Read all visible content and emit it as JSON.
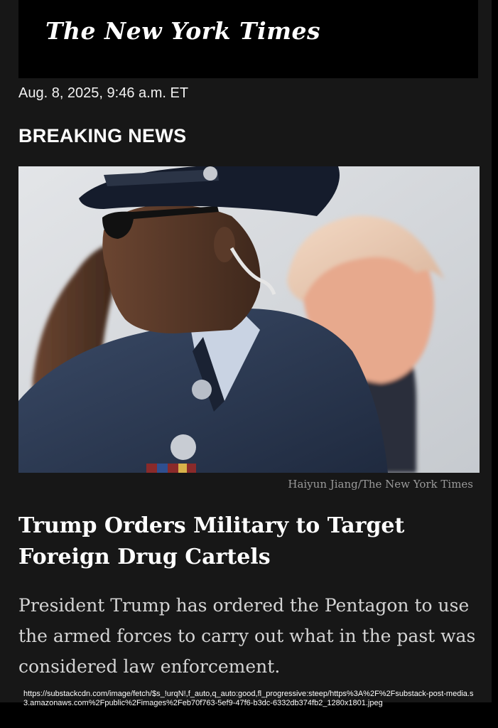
{
  "masthead": {
    "title": "The New York Times"
  },
  "dateline": "Aug. 8, 2025, 9:46 a.m. ET",
  "label": "BREAKING NEWS",
  "photo": {
    "credit": "Haiyun Jiang/The New York Times"
  },
  "article": {
    "headline": "Trump Orders Military to Target Foreign Drug Cartels",
    "summary": "President Trump has ordered the Pentagon to use the armed forces to carry out what in the past was considered law enforcement."
  },
  "source_url": "https://substackcdn.com/image/fetch/$s_!urqN!,f_auto,q_auto:good,fl_progressive:steep/https%3A%2F%2Fsubstack-post-media.s3.amazonaws.com%2Fpublic%2Fimages%2Feb70f763-5ef9-47f6-b3dc-6332db374fb2_1280x1801.jpeg",
  "colors": {
    "page_background": "#171717",
    "masthead_background": "#000000",
    "text_primary": "#ffffff",
    "text_secondary": "#d4d4d4",
    "credit_text": "#9a9a9a"
  }
}
